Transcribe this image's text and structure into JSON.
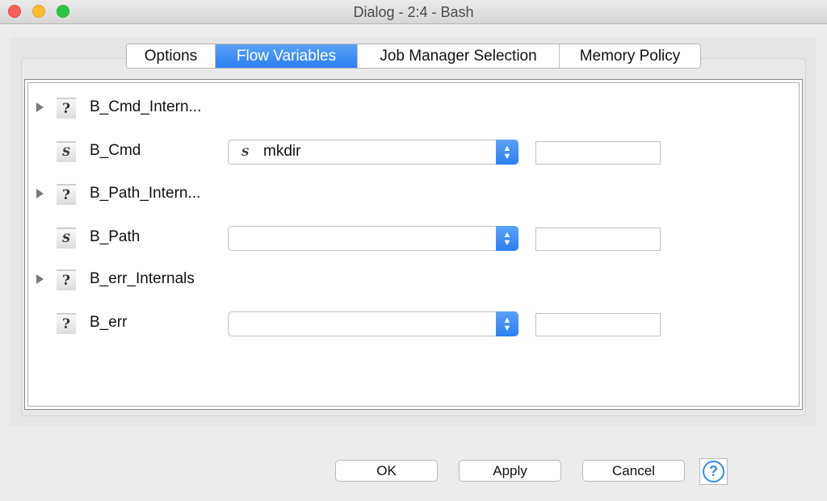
{
  "window": {
    "title": "Dialog - 2:4 - Bash"
  },
  "tabs": [
    {
      "label": "Options"
    },
    {
      "label": "Flow Variables"
    },
    {
      "label": "Job Manager Selection"
    },
    {
      "label": "Memory Policy"
    }
  ],
  "active_tab": "Flow Variables",
  "variables": [
    {
      "name": "B_Cmd_Intern...",
      "icon": "?",
      "expandable": true
    },
    {
      "name": "B_Cmd",
      "icon": "S",
      "combo_value": "mkdir",
      "combo_icon": "S",
      "text_value": ""
    },
    {
      "name": "B_Path_Intern...",
      "icon": "?",
      "expandable": true
    },
    {
      "name": "B_Path",
      "icon": "S",
      "combo_value": "",
      "text_value": ""
    },
    {
      "name": "B_err_Internals",
      "icon": "?",
      "expandable": true
    },
    {
      "name": "B_err",
      "icon": "?",
      "combo_value": "",
      "text_value": ""
    }
  ],
  "buttons": {
    "ok": "OK",
    "apply": "Apply",
    "cancel": "Cancel",
    "help": "?"
  },
  "colors": {
    "accent": "#2b7ff2",
    "help": "#2f8cf0"
  }
}
